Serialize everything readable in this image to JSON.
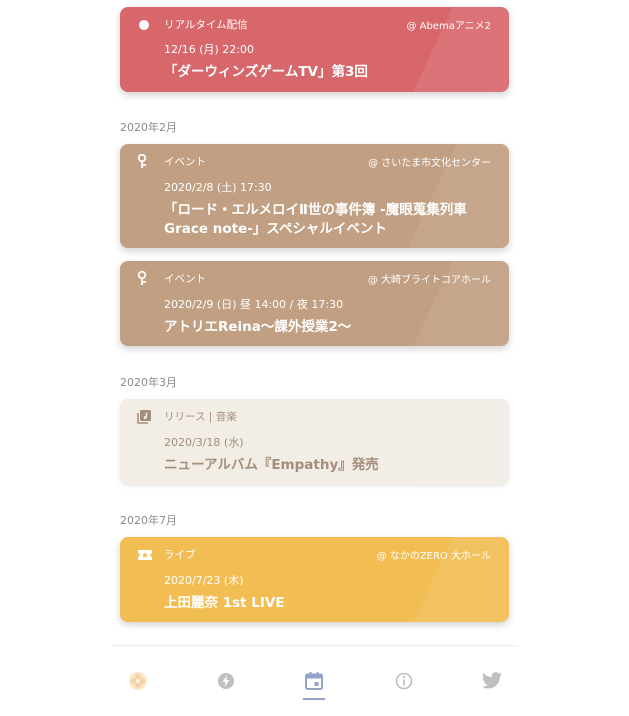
{
  "events": [
    {
      "type": "リアルタイム配信",
      "venue": "@ Abemaアニメ2",
      "date": "12/16 (月)  22:00",
      "title_lines": [
        "「ダーウィンズゲームTV」第3回"
      ],
      "icon": "circle-icon"
    },
    {
      "month": "2020年2月",
      "type": "イベント",
      "venue": "@ さいたま市文化センター",
      "date": "2020/2/8 (土)  17:30",
      "title_lines": [
        "「ロード・エルメロイⅡ世の事件簿 -魔眼蒐集列車",
        "Grace note-」スペシャルイベント"
      ],
      "icon": "microphone-icon"
    },
    {
      "type": "イベント",
      "venue": "@ 大崎ブライトコアホール",
      "date": "2020/2/9 (日)  昼 14:00 / 夜 17:30",
      "title_lines": [
        "アトリエReina～課外授業2～"
      ],
      "icon": "microphone-icon"
    },
    {
      "month": "2020年3月",
      "type": "リリース | 音楽",
      "venue": "",
      "date": "2020/3/18 (水)",
      "title_lines": [
        "ニューアルバム『Empathy』発売"
      ],
      "icon": "music-library-icon"
    },
    {
      "month": "2020年7月",
      "type": "ライブ",
      "venue": "@ なかのZERO 大ホール",
      "date": "2020/7/23 (木)",
      "title_lines": [
        "上田麗奈 1st LIVE"
      ],
      "icon": "ticket-icon"
    }
  ],
  "colors": {
    "stream": "#d8676c",
    "event": "#c09f82",
    "release": "#f2ede5",
    "live": "#f2bd52",
    "nav_active": "#93a3c9",
    "nav_inactive": "#bfbfbf"
  },
  "nav": [
    {
      "icon": "flower-logo-icon",
      "active": false
    },
    {
      "icon": "lightning-icon",
      "active": false
    },
    {
      "icon": "calendar-icon",
      "active": true
    },
    {
      "icon": "info-icon",
      "active": false
    },
    {
      "icon": "twitter-icon",
      "active": false
    }
  ]
}
